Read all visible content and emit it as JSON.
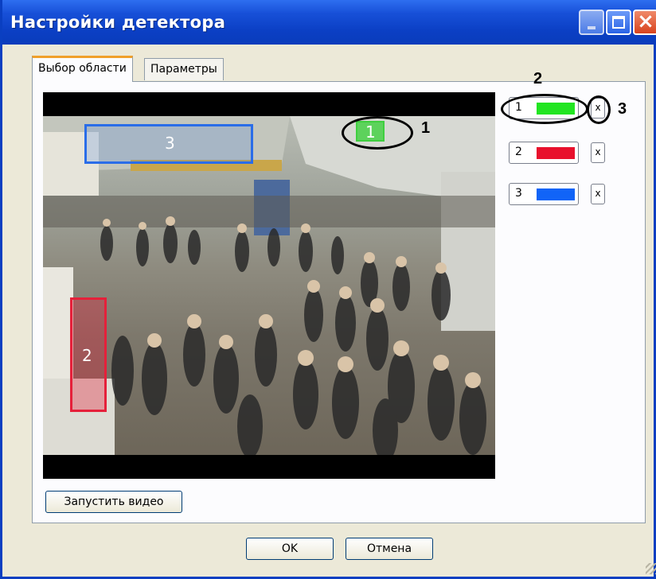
{
  "window": {
    "title": "Настройки детектора"
  },
  "tabs": [
    {
      "label": "Выбор области",
      "active": true
    },
    {
      "label": "Параметры",
      "active": false
    }
  ],
  "video": {
    "zones": [
      {
        "label": "1",
        "color": "#3fcf3f"
      },
      {
        "label": "2",
        "color": "#e5203a"
      },
      {
        "label": "3",
        "color": "#2a6de8"
      }
    ]
  },
  "regions": [
    {
      "number": "1",
      "color": "#22e522",
      "delete_label": "x"
    },
    {
      "number": "2",
      "color": "#e8102c",
      "delete_label": "x"
    },
    {
      "number": "3",
      "color": "#1164f7",
      "delete_label": "x"
    }
  ],
  "annotations": {
    "callout_1": "1",
    "callout_2": "2",
    "callout_3": "3"
  },
  "buttons": {
    "start_video": "Запустить видео",
    "ok": "OK",
    "cancel": "Отмена"
  }
}
